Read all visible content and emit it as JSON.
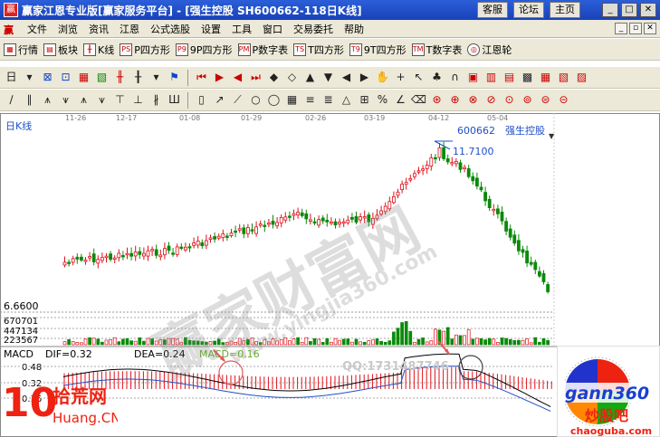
{
  "window": {
    "app_title": "赢家江恩专业版[赢家服务平台] - [强生控股   SH600662-118日K线]",
    "buttons": [
      "客服",
      "论坛",
      "主页"
    ]
  },
  "menu": [
    "文件",
    "浏览",
    "资讯",
    "江恩",
    "公式选股",
    "设置",
    "工具",
    "窗口",
    "交易委托",
    "帮助"
  ],
  "toolbar": [
    "行情",
    "板块",
    "K线",
    "P四方形",
    "9P四方形",
    "P数字表",
    "T四方形",
    "9T四方形",
    "T数字表",
    "江恩轮"
  ],
  "toolbar_icons": {
    "frame1": "PS",
    "frame2": "P9",
    "frame3": "PM",
    "frame4": "TS",
    "frame5": "T9",
    "frame6": "TM"
  },
  "chart": {
    "label": "日K线",
    "stock_code": "600662",
    "stock_name": "强生控股",
    "high_label": "11.7100",
    "low_label": "6.6600",
    "dates": [
      "11-26",
      "12-17",
      "01-08",
      "01-29",
      "02-26",
      "03-19",
      "04-12",
      "05-04"
    ],
    "volume_labels": [
      "670701",
      "447134",
      "223567"
    ],
    "macd": {
      "label": "MACD",
      "dif": "DIF=0.32",
      "dea": "DEA=0.24",
      "macd": "MACD=0.16",
      "axis": [
        "0.48",
        "0.32",
        "0.16"
      ]
    },
    "qq": "QQ:1731487746"
  },
  "watermarks": {
    "main": "赢家财富网",
    "url": "www.yingjia360.com",
    "left_logo_num": "10",
    "left_logo_cn": "拾荒网",
    "left_logo_en": "Huang.CN",
    "right_logo": "gann360",
    "right_cn": "炒股吧",
    "right_url": "chaoguba.com"
  },
  "colors": {
    "up": "#e0101a",
    "down": "#0a8a0a",
    "title": "#1f4fc8"
  }
}
